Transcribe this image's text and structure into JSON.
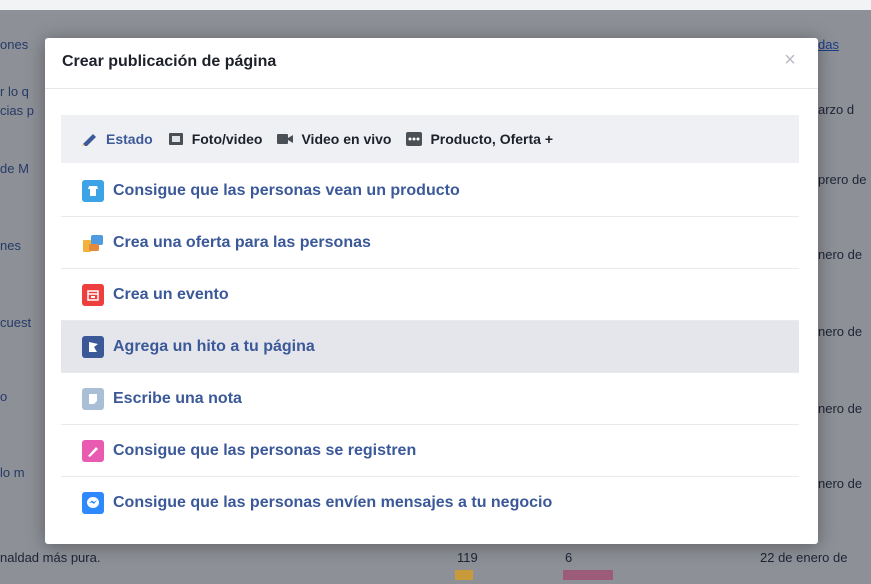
{
  "background": {
    "left_fragments": [
      "ones",
      "r lo q",
      "cias p",
      "de M",
      "nes",
      "cuest",
      "o",
      "lo m"
    ],
    "right_fragments": [
      "arzo d",
      "prero de",
      "nero de",
      "nero de",
      "nero de",
      "nero de"
    ],
    "top_right_link": "das",
    "bottom_left": "naldad más pura.",
    "bottom_num1": "119",
    "bottom_num2": "6",
    "bottom_right": "22 de enero de"
  },
  "modal": {
    "title": "Crear publicación de página",
    "close_label": "×",
    "tabs": [
      {
        "label": "Estado",
        "icon": "pencil-icon"
      },
      {
        "label": "Foto/video",
        "icon": "photo-icon"
      },
      {
        "label": "Video en vivo",
        "icon": "live-video-icon"
      },
      {
        "label": "Producto, Oferta +",
        "icon": "more-icon"
      }
    ],
    "options": [
      {
        "label": "Consigue que las personas vean un producto",
        "icon": "product-icon",
        "color": "#3ba3e6"
      },
      {
        "label": "Crea una oferta para las personas",
        "icon": "offer-icon",
        "color": "#e8a33c"
      },
      {
        "label": "Crea un evento",
        "icon": "calendar-icon",
        "color": "#ef3e3e"
      },
      {
        "label": "Agrega un hito a tu página",
        "icon": "flag-icon",
        "color": "#3b5998"
      },
      {
        "label": "Escribe una nota",
        "icon": "note-icon",
        "color": "#a9bfd6"
      },
      {
        "label": "Consigue que las personas se registren",
        "icon": "signup-icon",
        "color": "#e95bb0"
      },
      {
        "label": "Consigue que las personas envíen mensajes a tu negocio",
        "icon": "messenger-icon",
        "color": "#2e89ff"
      }
    ]
  }
}
